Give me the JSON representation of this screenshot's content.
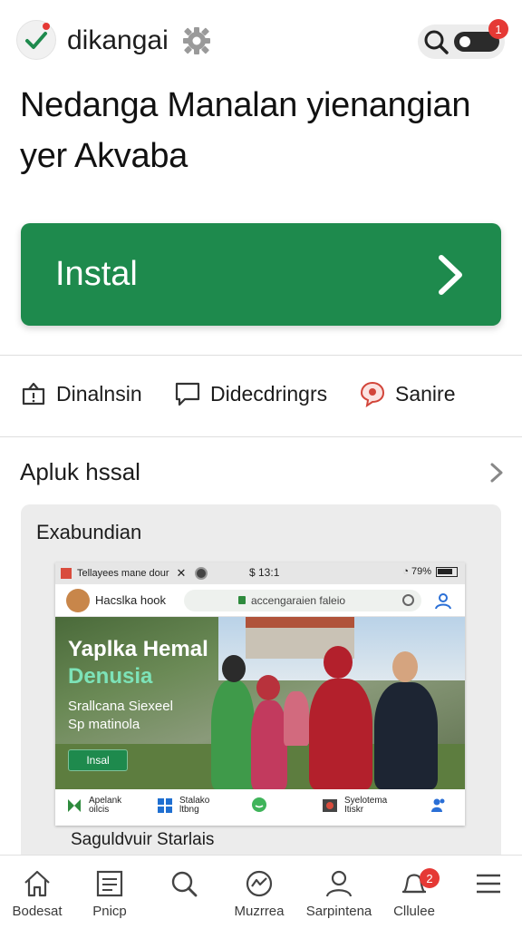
{
  "header": {
    "app_name": "dikangai",
    "notification_count": "1",
    "logo_color": "#1e8a4d"
  },
  "headline": {
    "line1": "Nedanga Manalan yienangian",
    "line2": "yer Akvaba"
  },
  "install_button": {
    "label": "Instal",
    "color": "#1e8a4d"
  },
  "actions": [
    {
      "label": "Dinalnsin",
      "icon": "share-bag-icon"
    },
    {
      "label": "Didecdringrs",
      "icon": "comment-icon"
    },
    {
      "label": "Sanire",
      "icon": "pin-icon"
    }
  ],
  "section": {
    "title": "Apluk hssal",
    "card_title": "Exabundian",
    "footer": "Saguldvuir Starlais"
  },
  "preview": {
    "tab_title": "Tellayees mane dour",
    "clock": "$ 13:1",
    "battery_text": "79%",
    "site_name": "Hacslka hook",
    "url": "accengaraien faleio",
    "hero_title1": "Yaplka Hemal",
    "hero_title2": "Denusia",
    "hero_sub1": "Srallcana Siexeel",
    "hero_sub2": "Sp matinola",
    "hero_cta": "Insal",
    "nav": [
      {
        "line1": "Apelank",
        "line2": "oilcis",
        "icon": "puzzle-icon"
      },
      {
        "line1": "Stalako",
        "line2": "ltbng",
        "icon": "windows-icon"
      },
      {
        "line1": "",
        "line2": "",
        "icon": "chat-icon"
      },
      {
        "line1": "Syelotema",
        "line2": "Itiskr",
        "icon": "security-icon"
      },
      {
        "line1": "",
        "line2": "",
        "icon": "users-icon"
      }
    ]
  },
  "bottom_nav": [
    {
      "label": "Bodesat",
      "icon": "home-icon"
    },
    {
      "label": "Pnicp",
      "icon": "list-icon"
    },
    {
      "label": "",
      "icon": "search-icon"
    },
    {
      "label": "Muzrrea",
      "icon": "gauge-icon"
    },
    {
      "label": "Sarpintena",
      "icon": "profile-icon"
    },
    {
      "label": "Cllulee",
      "icon": "bell-icon",
      "badge": "2"
    },
    {
      "label": "",
      "icon": "menu-icon"
    }
  ]
}
